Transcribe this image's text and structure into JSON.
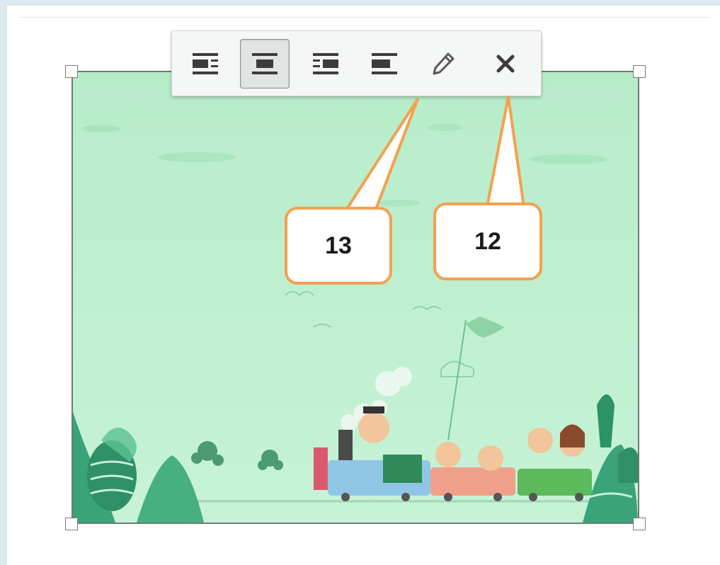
{
  "toolbar": {
    "buttons": [
      {
        "icon": "align-left-wrap-icon",
        "active": false
      },
      {
        "icon": "align-center-icon",
        "active": true
      },
      {
        "icon": "align-right-wrap-icon",
        "active": false
      },
      {
        "icon": "align-none-icon",
        "active": false
      },
      {
        "icon": "pencil-edit-icon",
        "active": false
      },
      {
        "icon": "close-remove-icon",
        "active": false
      }
    ]
  },
  "callouts": [
    {
      "label": "13",
      "points_to": "pencil-edit-icon"
    },
    {
      "label": "12",
      "points_to": "close-remove-icon"
    }
  ],
  "colors": {
    "callout_border": "#f5a04f",
    "image_background": "#bdeecf",
    "icon": "#3c3c3c"
  }
}
